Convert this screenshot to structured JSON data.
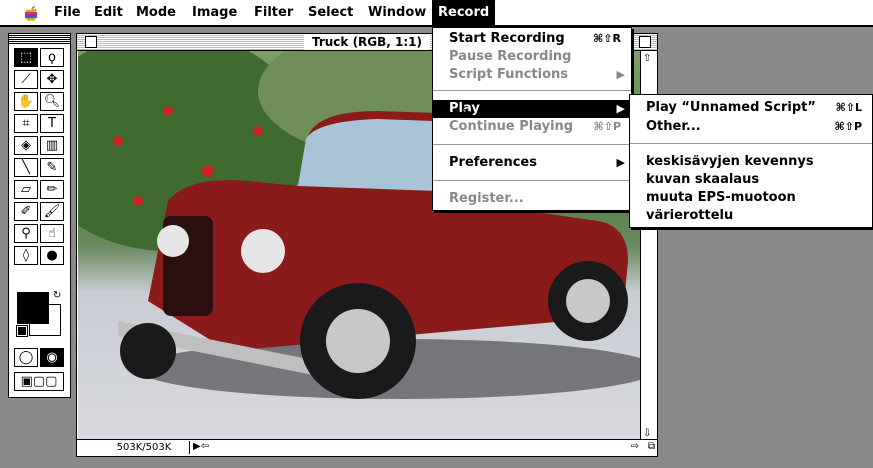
{
  "menubar": {
    "items": [
      "File",
      "Edit",
      "Mode",
      "Image",
      "Filter",
      "Select",
      "Window",
      "Record"
    ]
  },
  "document": {
    "title": "Truck (RGB, 1:1)",
    "size_readout": "503K/503K"
  },
  "record_menu": {
    "items": [
      {
        "label": "Start Recording",
        "shortcut": "⌘⇧R"
      },
      {
        "label": "Pause Recording"
      },
      {
        "label": "Script Functions"
      },
      {
        "label": "Play"
      },
      {
        "label": "Continue Playing",
        "shortcut": "⌘⇧P"
      },
      {
        "label": "Preferences"
      },
      {
        "label": "Register..."
      }
    ]
  },
  "play_menu": {
    "items": [
      {
        "label": "Play “Unnamed Script”",
        "shortcut": "⌘⇧L"
      },
      {
        "label": "Other...",
        "shortcut": "⌘⇧P"
      },
      {
        "label": "keskisävyjen kevennys"
      },
      {
        "label": "kuvan skaalaus"
      },
      {
        "label": "muuta EPS-muotoon"
      },
      {
        "label": "värierottelu"
      }
    ]
  }
}
